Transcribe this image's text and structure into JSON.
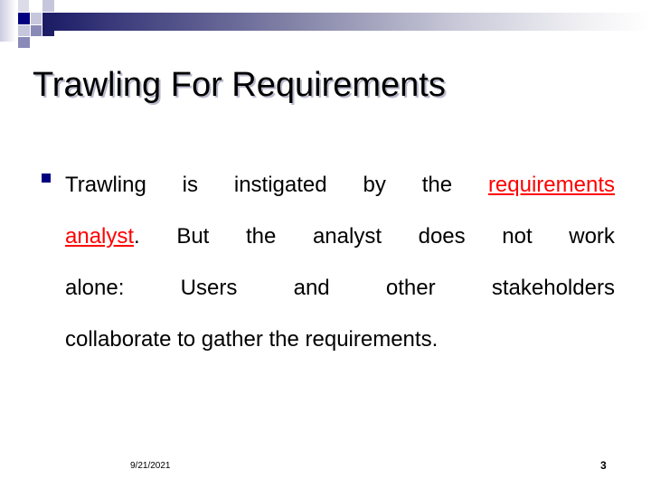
{
  "slide": {
    "title": "Trawling For Requirements",
    "page_number": "3",
    "date": "9/21/2021",
    "accent_navy": "#000080",
    "highlight_red": "#ff0000",
    "band_gradient_start": "#1b1b64",
    "band_gradient_end": "#ffffff"
  },
  "body": {
    "bullet_marker": "square-bullet",
    "line1": {
      "w1": "Trawling",
      "w2": "is",
      "w3": "instigated",
      "w4": "by",
      "w5": "the",
      "w6_highlight": "requirements"
    },
    "line2": {
      "w1_highlight": "analyst",
      "w1_tail": ".",
      "w2": "But",
      "w3": "the",
      "w4": "analyst",
      "w5": "does",
      "w6": "not",
      "w7": "work"
    },
    "line3": {
      "w1": "alone:",
      "w2": "Users",
      "w3": "and",
      "w4": "other",
      "w5": "stakeholders"
    },
    "line4": {
      "text": "collaborate to gather the requirements."
    },
    "full_text": "Trawling is instigated by the requirements analyst. But the analyst does not work alone: Users and other stakeholders collaborate to gather the requirements."
  }
}
